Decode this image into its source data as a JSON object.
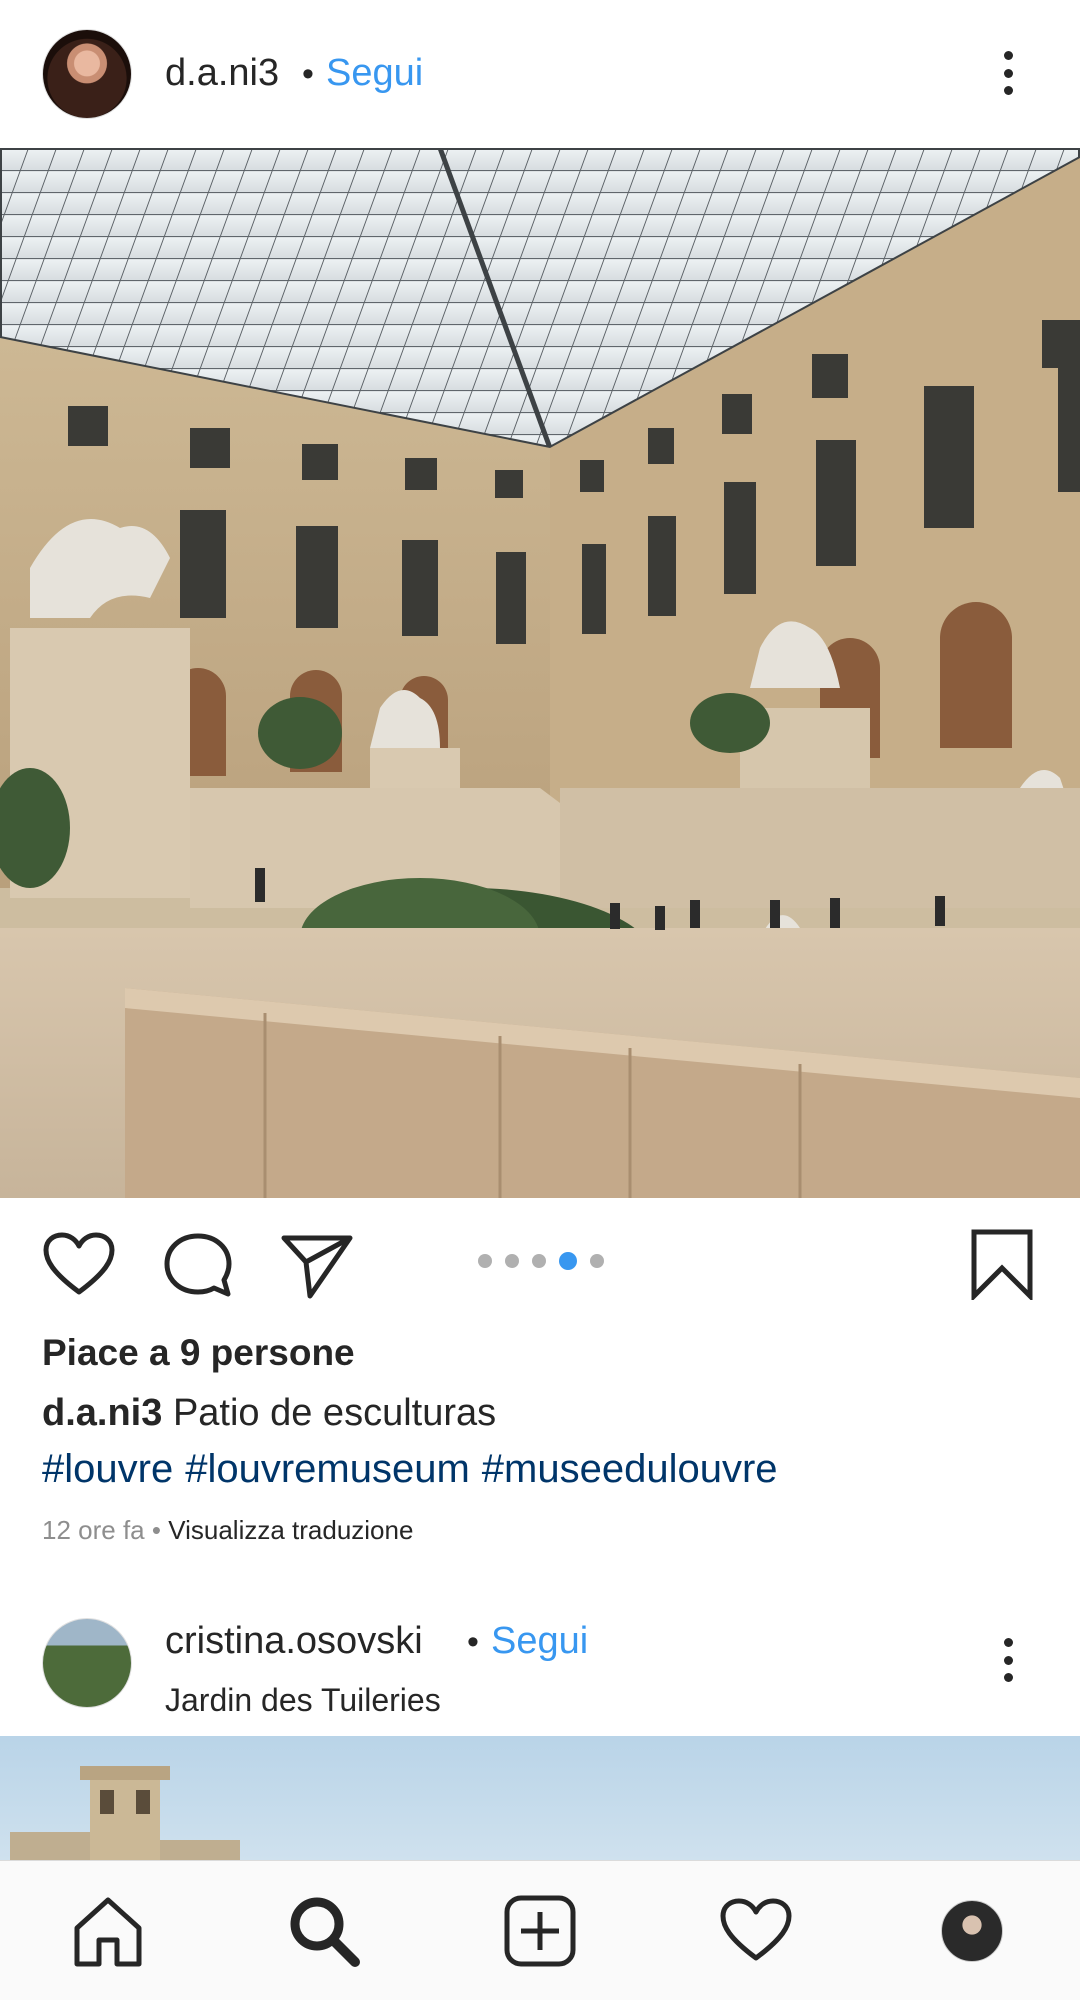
{
  "post1": {
    "username": "d.a.ni3",
    "separator": "•",
    "follow_label": "Segui",
    "likes_text": "Piace a 9 persone",
    "caption_user": "d.a.ni3",
    "caption_text": "Patio de esculturas",
    "hashtags": [
      "#louvre",
      "#louvremuseum",
      "#museedulouvre"
    ],
    "time_text": "12 ore fa",
    "meta_separator": "•",
    "translate_label": "Visualizza traduzione",
    "carousel": {
      "total": 5,
      "active_index": 3
    }
  },
  "post2": {
    "username": "cristina.osovski",
    "separator": "•",
    "follow_label": "Segui",
    "location": "Jardin des Tuileries"
  },
  "icons": {
    "more": "more-vertical-icon",
    "like": "heart-icon",
    "comment": "comment-icon",
    "share": "paper-plane-icon",
    "save": "bookmark-icon",
    "nav_home": "home-icon",
    "nav_search": "search-icon",
    "nav_add": "add-post-icon",
    "nav_activity": "heart-icon",
    "nav_profile": "profile-avatar"
  },
  "colors": {
    "accent": "#3897f0",
    "hashtag": "#003569",
    "text": "#262626",
    "muted": "#8e8e8e"
  }
}
